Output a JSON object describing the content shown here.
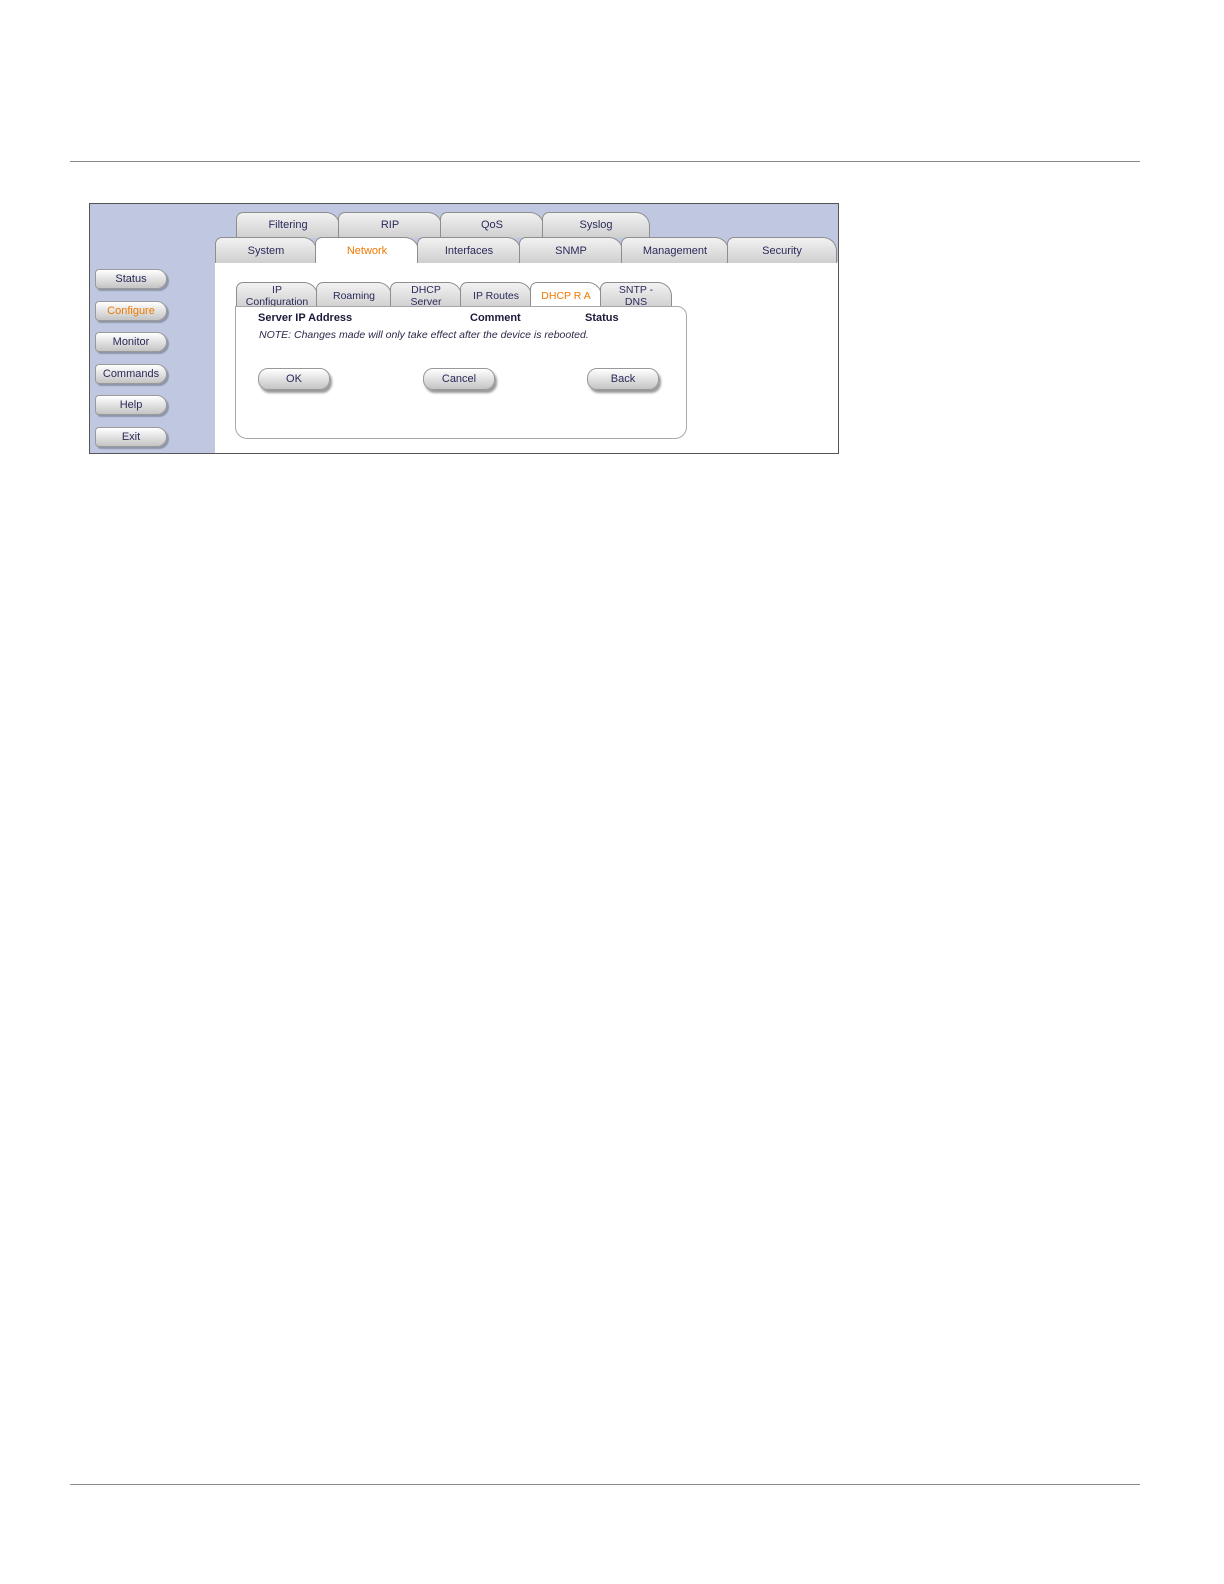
{
  "row1_tabs": [
    "Filtering",
    "RIP",
    "QoS",
    "Syslog"
  ],
  "row2_tabs": [
    "System",
    "Network",
    "Interfaces",
    "SNMP",
    "Management",
    "Security"
  ],
  "row3_tabs": [
    {
      "line1": "IP",
      "line2": "Configuration"
    },
    {
      "line1": "Roaming",
      "line2": ""
    },
    {
      "line1": "DHCP",
      "line2": "Server"
    },
    {
      "line1": "IP Routes",
      "line2": ""
    },
    {
      "line1": "DHCP R A",
      "line2": ""
    },
    {
      "line1": "SNTP -",
      "line2": "DNS"
    }
  ],
  "nav": [
    "Status",
    "Configure",
    "Monitor",
    "Commands",
    "Help",
    "Exit"
  ],
  "columns": [
    "Server IP Address",
    "Comment",
    "Status"
  ],
  "note": "NOTE: Changes made will only take effect after the device is rebooted.",
  "buttons": {
    "ok": "OK",
    "cancel": "Cancel",
    "back": "Back"
  },
  "colors": {
    "accent": "#f07800",
    "sidebar": "#bfc8e0"
  }
}
